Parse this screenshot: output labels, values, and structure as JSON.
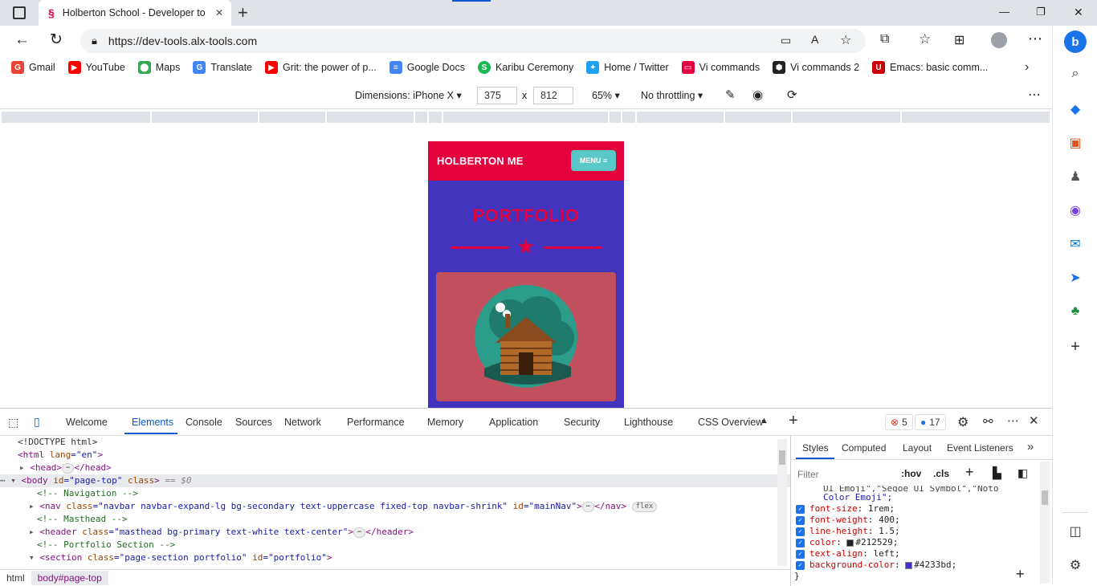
{
  "tab": {
    "title": "Holberton School - Developer to",
    "new_tab": "+"
  },
  "window": {
    "minimize": "—",
    "maximize": "❐",
    "close": "✕"
  },
  "address": {
    "url": "https://dev-tools.alx-tools.com"
  },
  "bookmarks": [
    {
      "label": "Gmail",
      "color": "#ea4335",
      "icon": "G"
    },
    {
      "label": "YouTube",
      "color": "#ff0000",
      "icon": "▶"
    },
    {
      "label": "Maps",
      "color": "#34a853",
      "icon": "⬤"
    },
    {
      "label": "Translate",
      "color": "#4285f4",
      "icon": "G"
    },
    {
      "label": "Grit: the power of p...",
      "color": "#ff0000",
      "icon": "▶"
    },
    {
      "label": "Google Docs",
      "color": "#4285f4",
      "icon": "≡"
    },
    {
      "label": "Karibu Ceremony",
      "color": "#1db954",
      "icon": "S"
    },
    {
      "label": "Home / Twitter",
      "color": "#1da1f2",
      "icon": "✦"
    },
    {
      "label": "Vi commands",
      "color": "#e4003d",
      "icon": "▭"
    },
    {
      "label": "Vi commands 2",
      "color": "#222222",
      "icon": "⬢"
    },
    {
      "label": "Emacs: basic comm...",
      "color": "#cc0000",
      "icon": "U"
    }
  ],
  "device_toolbar": {
    "dimensions": "Dimensions: iPhone X",
    "width": "375",
    "times": "x",
    "height": "812",
    "zoom": "65%",
    "throttling": "No throttling"
  },
  "phone": {
    "brand": "HOLBERTON ME",
    "menu": "MENU ≡",
    "title": "PORTFOLIO"
  },
  "devtools": {
    "tabs": [
      "Welcome",
      "Elements",
      "Console",
      "Sources",
      "Network",
      "Performance",
      "Memory",
      "Application",
      "Security",
      "Lighthouse",
      "CSS Overview"
    ],
    "errors": "5",
    "messages": "17",
    "lines": {
      "l0": "<!DOCTYPE html>",
      "l1a": "<html ",
      "l1b": "lang",
      "l1c": "=\"en\"",
      "l1d": ">",
      "l2a": "<head>",
      "l2b": "</head>",
      "l3a": "<body ",
      "l3b": "id",
      "l3c": "=\"page-top\"",
      "l3d": " class",
      "l3e": ">",
      "l3f": " == $0",
      "l4": "<!-- Navigation -->",
      "l5a": "<nav ",
      "l5b": "class",
      "l5c": "=\"navbar navbar-expand-lg bg-secondary text-uppercase fixed-top navbar-shrink\"",
      "l5d": " id",
      "l5e": "=\"mainNav\"",
      "l5f": ">",
      "l5g": "</nav>",
      "l5h": "flex",
      "l6": "<!-- Masthead -->",
      "l7a": "<header ",
      "l7b": "class",
      "l7c": "=\"masthead bg-primary text-white text-center\"",
      "l7d": ">",
      "l7e": "</header>",
      "l8": "<!-- Portfolio Section -->",
      "l9a": "<section ",
      "l9b": "class",
      "l9c": "=\"page-section portfolio\"",
      "l9d": " id",
      "l9e": "=\"portfolio\"",
      "l9f": ">"
    },
    "breadcrumbs": [
      "html",
      "body#page-top"
    ],
    "styles_tabs": [
      "Styles",
      "Computed",
      "Layout",
      "Event Listeners"
    ],
    "filter_placeholder": "Filter",
    "hov": ":hov",
    "cls": ".cls",
    "styles_overflow": "UI Emoji\",\"Segoe UI Symbol\",\"Noto",
    "styles_cont": "Color Emoji\";",
    "props": [
      {
        "name": "font-size",
        "value": "1rem;"
      },
      {
        "name": "font-weight",
        "value": "400;"
      },
      {
        "name": "line-height",
        "value": "1.5;"
      },
      {
        "name": "color",
        "value": "#212529;",
        "swatch": "#212529"
      },
      {
        "name": "text-align",
        "value": "left;"
      },
      {
        "name": "background-color",
        "value": "#4233bd;",
        "swatch": "#4233bd"
      }
    ],
    "closing_brace": "}"
  }
}
